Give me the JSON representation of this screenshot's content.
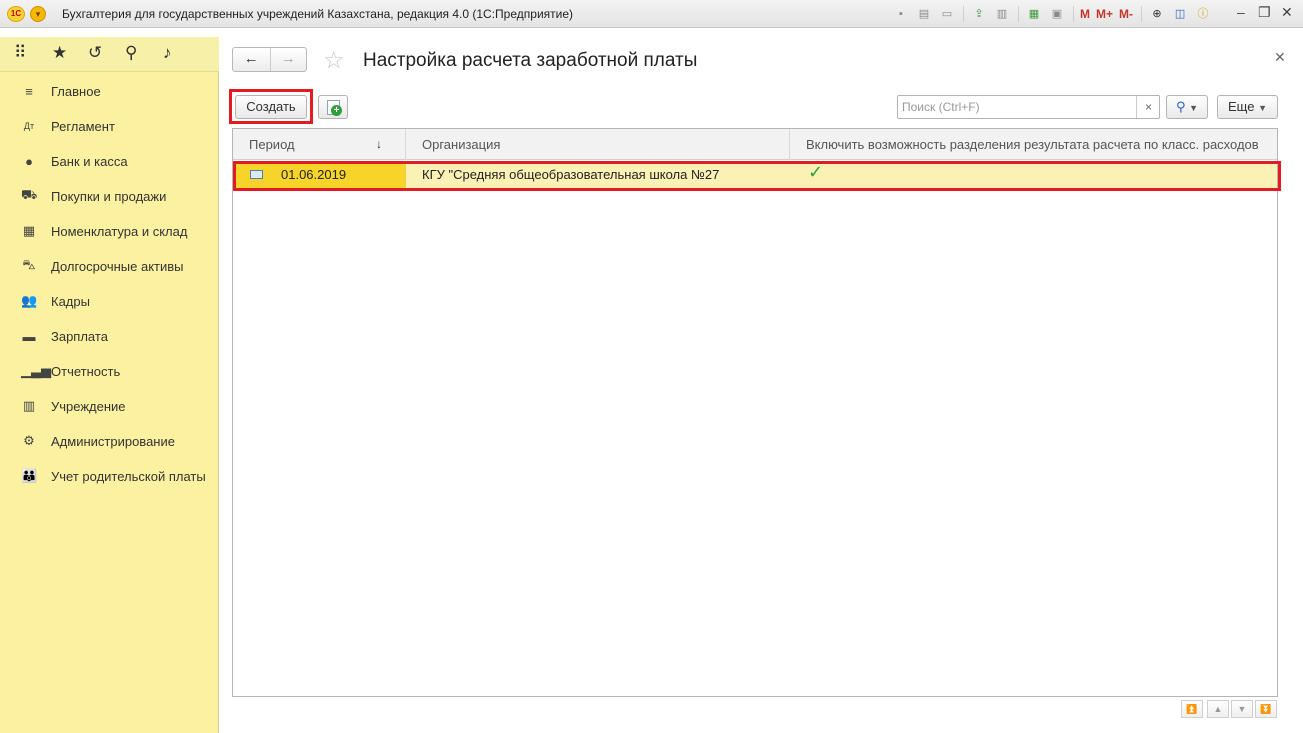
{
  "window": {
    "logo": "1С",
    "title": "Бухгалтерия для государственных учреждений Казахстана, редакция 4.0  (1С:Предприятие)",
    "toolbar_m": [
      "M",
      "M+",
      "M-"
    ]
  },
  "topnav": {
    "icons": [
      "apps-grid-icon",
      "star-icon",
      "history-icon",
      "search-icon",
      "bell-icon"
    ]
  },
  "sidebar": {
    "items": [
      {
        "label": "Главное",
        "icon": "menu-lines-icon"
      },
      {
        "label": "Регламент",
        "icon": "reglament-icon"
      },
      {
        "label": "Банк и касса",
        "icon": "coin-icon"
      },
      {
        "label": "Покупки и продажи",
        "icon": "cart-icon"
      },
      {
        "label": "Номенклатура и склад",
        "icon": "warehouse-icon"
      },
      {
        "label": "Долгосрочные активы",
        "icon": "truck-icon"
      },
      {
        "label": "Кадры",
        "icon": "people-icon"
      },
      {
        "label": "Зарплата",
        "icon": "wallet-icon"
      },
      {
        "label": "Отчетность",
        "icon": "bar-chart-icon"
      },
      {
        "label": "Учреждение",
        "icon": "building-icon"
      },
      {
        "label": "Администрирование",
        "icon": "gear-icon"
      },
      {
        "label": "Учет родительской платы",
        "icon": "family-icon"
      }
    ]
  },
  "page": {
    "title": "Настройка расчета заработной платы"
  },
  "toolbar": {
    "create_label": "Создать",
    "search_placeholder": "Поиск (Ctrl+F)",
    "search_clear": "×",
    "more_label": "Еще"
  },
  "table": {
    "columns": [
      "Период",
      "Организация",
      "Включить возможность разделения результата расчета по класс. расходов"
    ],
    "rows": [
      {
        "period": "01.06.2019",
        "organization": "КГУ \"Средняя общеобразовательная школа №27",
        "split_enabled": "✓"
      }
    ]
  },
  "colors": {
    "sidebar_bg": "#fbf1a1",
    "selected_row": "#fbf1b4",
    "selected_cell": "#f6d42a",
    "highlight_frame": "#e31b23",
    "check": "#2aa43a"
  }
}
